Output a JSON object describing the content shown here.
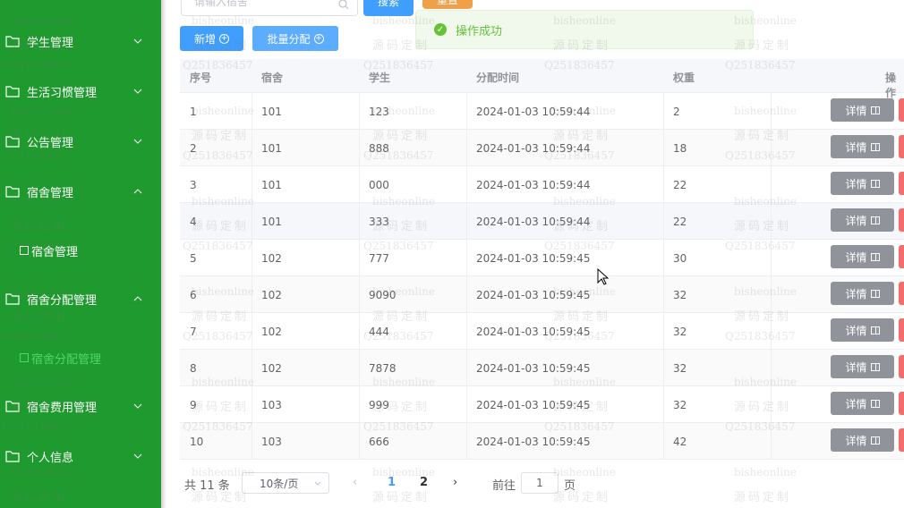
{
  "sidebar": {
    "menu": [
      {
        "label": "学生管理"
      },
      {
        "label": "生活习惯管理"
      },
      {
        "label": "公告管理"
      },
      {
        "label": "宿舍管理"
      },
      {
        "label": "宿舍分配管理"
      },
      {
        "label": "宿舍费用管理"
      },
      {
        "label": "个人信息"
      }
    ],
    "sub_dorm": "宿舍管理",
    "sub_alloc": "宿舍分配管理",
    "bg_color": "#1f9a2e",
    "active_color": "#4cd964"
  },
  "toolbar": {
    "search_placeholder": "请输入宿舍",
    "search_label": "搜索",
    "reset_label": "重置",
    "add_label": "新增",
    "batch_label": "批量分配"
  },
  "toast": {
    "message": "操作成功"
  },
  "table": {
    "headers": [
      "序号",
      "宿舍",
      "学生",
      "分配时间",
      "权重",
      "操作"
    ],
    "detail_label": "详情",
    "rows": [
      [
        "1",
        "101",
        "123",
        "2024-01-03 10:59:44",
        "2"
      ],
      [
        "2",
        "101",
        "888",
        "2024-01-03 10:59:44",
        "18"
      ],
      [
        "3",
        "101",
        "000",
        "2024-01-03 10:59:44",
        "22"
      ],
      [
        "4",
        "101",
        "333",
        "2024-01-03 10:59:44",
        "22"
      ],
      [
        "5",
        "102",
        "777",
        "2024-01-03 10:59:45",
        "30"
      ],
      [
        "6",
        "102",
        "9090",
        "2024-01-03 10:59:45",
        "32"
      ],
      [
        "7",
        "102",
        "444",
        "2024-01-03 10:59:45",
        "32"
      ],
      [
        "8",
        "102",
        "7878",
        "2024-01-03 10:59:45",
        "32"
      ],
      [
        "9",
        "103",
        "999",
        "2024-01-03 10:59:45",
        "32"
      ],
      [
        "10",
        "103",
        "666",
        "2024-01-03 10:59:45",
        "42"
      ]
    ]
  },
  "pagination": {
    "total": "共 11 条",
    "page_size": "10条/页",
    "pages": [
      "1",
      "2"
    ],
    "current": "1",
    "goto_label": "前往",
    "goto_value": "1",
    "page_suffix": "页"
  },
  "watermark": {
    "line1": "bisheonline",
    "line2": "源码定制",
    "line3": "Q251836457"
  }
}
